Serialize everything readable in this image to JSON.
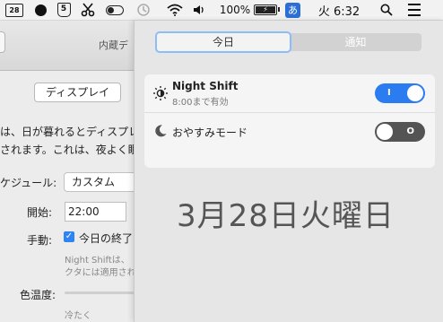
{
  "menubar": {
    "calendar_badge": "28",
    "shield_badge": "5",
    "battery_percent": "100%",
    "ime_label": "あ",
    "clock": "火 6:32",
    "icons": [
      "calendar-icon",
      "record-dot-icon",
      "shield-icon",
      "scissors-icon",
      "toggle-icon",
      "time-machine-icon",
      "wifi-icon",
      "volume-icon",
      "battery-icon",
      "input-method-icon",
      "search-icon",
      "list-icon"
    ]
  },
  "background_window": {
    "title": "内蔵デ",
    "tab_display": "ディスプレイ",
    "desc_line1": "は、日が暮れるとディスプレ",
    "desc_line2": "されます。これは、夜よく眠",
    "schedule_label": "ケジュール:",
    "schedule_value": "カスタム",
    "start_label": "開始:",
    "start_value": "22:00",
    "manual_label": "手動:",
    "manual_check_text": "今日の終了",
    "note_line1": "Night Shiftは、",
    "note_line2": "クタには適用され",
    "color_temp_label": "色温度:",
    "less_warm_label": "冷たく"
  },
  "notification_center": {
    "tabs": [
      {
        "label": "今日",
        "active": true
      },
      {
        "label": "通知",
        "active": false
      }
    ],
    "night_shift": {
      "title": "Night Shift",
      "subtitle": "8:00まで有効",
      "toggle_state": "on",
      "toggle_mark": "I"
    },
    "do_not_disturb": {
      "label": "おやすみモード",
      "toggle_state": "off",
      "toggle_mark": "O"
    },
    "date": "3月28日火曜日"
  },
  "colors": {
    "toggle_on": "#2a7cf0",
    "toggle_off": "#545454",
    "ime_badge": "#2a6ed6",
    "checkbox": "#2e83f5"
  }
}
